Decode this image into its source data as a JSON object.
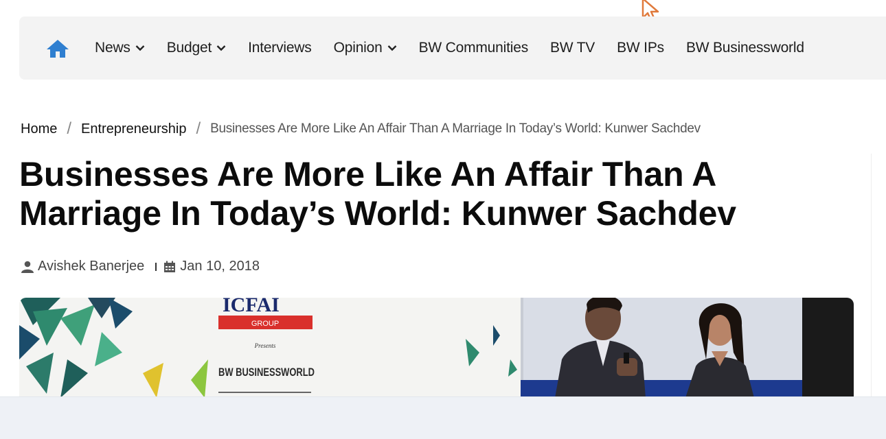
{
  "nav": {
    "home_icon": "home-icon",
    "items": [
      {
        "label": "News",
        "has_dropdown": true
      },
      {
        "label": "Budget",
        "has_dropdown": true
      },
      {
        "label": "Interviews",
        "has_dropdown": false
      },
      {
        "label": "Opinion",
        "has_dropdown": true
      },
      {
        "label": "BW Communities",
        "has_dropdown": false
      },
      {
        "label": "BW TV",
        "has_dropdown": false
      },
      {
        "label": "BW IPs",
        "has_dropdown": false
      },
      {
        "label": "BW Businessworld",
        "has_dropdown": false
      }
    ]
  },
  "breadcrumb": {
    "home": "Home",
    "section": "Entrepreneurship",
    "current": "Businesses Are More Like An Affair Than A Marriage In Today’s World: Kunwer Sachdev"
  },
  "article": {
    "title": "Businesses Are More Like An Affair Than A Marriage In Today’s World: Kunwer Sachdev",
    "author": "Avishek Banerjee",
    "date": "Jan 10, 2018",
    "author_icon": "user-icon",
    "date_icon": "calendar-icon"
  },
  "hero_image": {
    "sign_top": "ICFAI",
    "sign_group": "GROUP",
    "sign_presents": "Presents",
    "sign_brand": "BW BUSINESSWORLD"
  },
  "colors": {
    "accent": "#2f7fd0",
    "nav_bg": "#f3f3f3",
    "sign_red": "#d9302c"
  }
}
